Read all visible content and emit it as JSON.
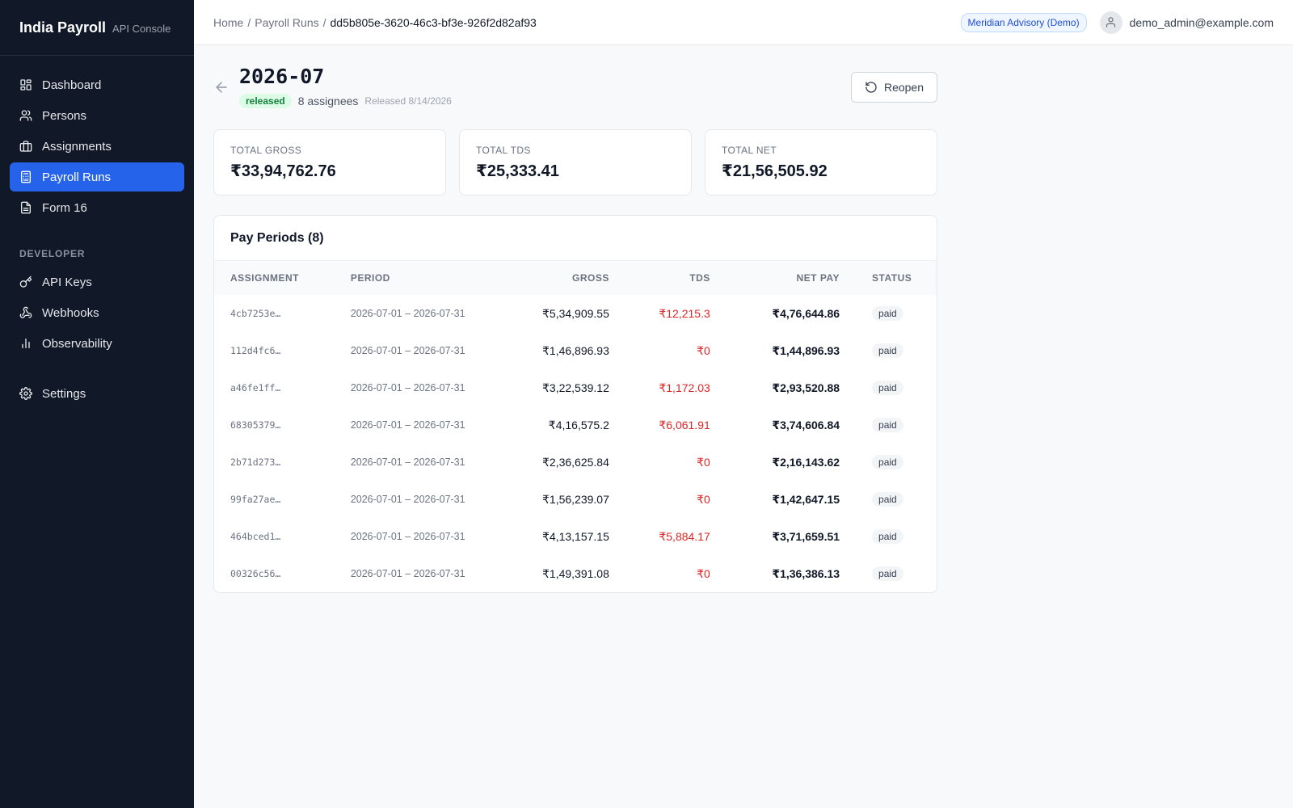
{
  "sidebar": {
    "brand": "India Payroll",
    "subtitle": "API Console",
    "items": [
      {
        "label": "Dashboard"
      },
      {
        "label": "Persons"
      },
      {
        "label": "Assignments"
      },
      {
        "label": "Payroll Runs"
      },
      {
        "label": "Form 16"
      }
    ],
    "developer_section": "DEVELOPER",
    "dev_items": [
      {
        "label": "API Keys"
      },
      {
        "label": "Webhooks"
      },
      {
        "label": "Observability"
      }
    ],
    "settings": "Settings"
  },
  "breadcrumb": {
    "home": "Home",
    "runs": "Payroll Runs",
    "current": "dd5b805e-3620-46c3-bf3e-926f2d82af93",
    "sep": "/"
  },
  "header": {
    "org": "Meridian Advisory (Demo)",
    "user": "demo_admin@example.com"
  },
  "run": {
    "title": "2026-07",
    "status": "released",
    "assignees": "8 assignees",
    "released": "Released 8/14/2026",
    "reopen_label": "Reopen"
  },
  "stats": [
    {
      "label": "TOTAL GROSS",
      "value": "₹33,94,762.76"
    },
    {
      "label": "TOTAL TDS",
      "value": "₹25,333.41"
    },
    {
      "label": "TOTAL NET",
      "value": "₹21,56,505.92"
    }
  ],
  "table": {
    "title": "Pay Periods (8)",
    "columns": [
      "ASSIGNMENT",
      "PERIOD",
      "GROSS",
      "TDS",
      "NET PAY",
      "STATUS"
    ],
    "rows": [
      {
        "assignment": "4cb7253e…",
        "period": "2026-07-01 – 2026-07-31",
        "gross": "₹5,34,909.55",
        "tds": "₹12,215.3",
        "net": "₹4,76,644.86",
        "status": "paid"
      },
      {
        "assignment": "112d4fc6…",
        "period": "2026-07-01 – 2026-07-31",
        "gross": "₹1,46,896.93",
        "tds": "₹0",
        "net": "₹1,44,896.93",
        "status": "paid"
      },
      {
        "assignment": "a46fe1ff…",
        "period": "2026-07-01 – 2026-07-31",
        "gross": "₹3,22,539.12",
        "tds": "₹1,172.03",
        "net": "₹2,93,520.88",
        "status": "paid"
      },
      {
        "assignment": "68305379…",
        "period": "2026-07-01 – 2026-07-31",
        "gross": "₹4,16,575.2",
        "tds": "₹6,061.91",
        "net": "₹3,74,606.84",
        "status": "paid"
      },
      {
        "assignment": "2b71d273…",
        "period": "2026-07-01 – 2026-07-31",
        "gross": "₹2,36,625.84",
        "tds": "₹0",
        "net": "₹2,16,143.62",
        "status": "paid"
      },
      {
        "assignment": "99fa27ae…",
        "period": "2026-07-01 – 2026-07-31",
        "gross": "₹1,56,239.07",
        "tds": "₹0",
        "net": "₹1,42,647.15",
        "status": "paid"
      },
      {
        "assignment": "464bced1…",
        "period": "2026-07-01 – 2026-07-31",
        "gross": "₹4,13,157.15",
        "tds": "₹5,884.17",
        "net": "₹3,71,659.51",
        "status": "paid"
      },
      {
        "assignment": "00326c56…",
        "period": "2026-07-01 – 2026-07-31",
        "gross": "₹1,49,391.08",
        "tds": "₹0",
        "net": "₹1,36,386.13",
        "status": "paid"
      }
    ]
  },
  "icons": {
    "dashboard": "dashboard-icon",
    "persons": "users-icon",
    "assignments": "briefcase-icon",
    "payroll_runs": "calculator-icon",
    "form16": "document-icon",
    "api_keys": "key-icon",
    "webhooks": "webhook-icon",
    "observability": "bar-chart-icon",
    "settings": "gear-icon",
    "back": "arrow-left-icon",
    "reopen": "rotate-ccw-icon",
    "user": "user-icon"
  },
  "colors": {
    "sidebar_bg": "#111827",
    "accent": "#2563eb",
    "tds_text": "#dc2626",
    "released_pill_bg": "#dcfce7",
    "released_pill_text": "#15803d"
  }
}
